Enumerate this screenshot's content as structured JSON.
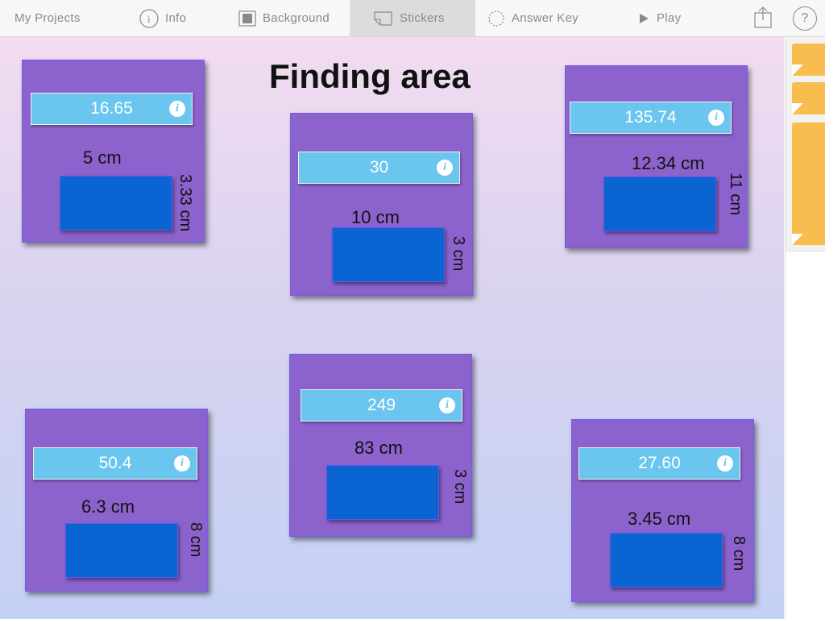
{
  "toolbar": {
    "my_projects": "My Projects",
    "info": "Info",
    "background": "Background",
    "stickers": "Stickers",
    "answer_key": "Answer Key",
    "play": "Play",
    "help": "?",
    "icons": [
      "info-icon",
      "background-icon",
      "stickers-icon",
      "answer-key-icon",
      "play-icon",
      "share-icon",
      "help-icon"
    ]
  },
  "canvas": {
    "title": "Finding area",
    "colors": {
      "card": "#8c63cc",
      "answer_box": "#6ac6ee",
      "rectangle": "#0a64d2"
    },
    "cards": [
      {
        "answer": "16.65",
        "width_label": "5 cm",
        "height_label": "3.33 cm"
      },
      {
        "answer": "30",
        "width_label": "10 cm",
        "height_label": "3 cm"
      },
      {
        "answer": "135.74",
        "width_label": "12.34 cm",
        "height_label": "11 cm"
      },
      {
        "answer": "50.4",
        "width_label": "6.3 cm",
        "height_label": "8 cm"
      },
      {
        "answer": "249",
        "width_label": "83 cm",
        "height_label": "3 cm"
      },
      {
        "answer": "27.60",
        "width_label": "3.45 cm",
        "height_label": "8 cm"
      }
    ],
    "info_glyph": "i"
  },
  "stickers_panel": {
    "sticker_color": "#f8bd4e",
    "sticker_count": 3
  }
}
